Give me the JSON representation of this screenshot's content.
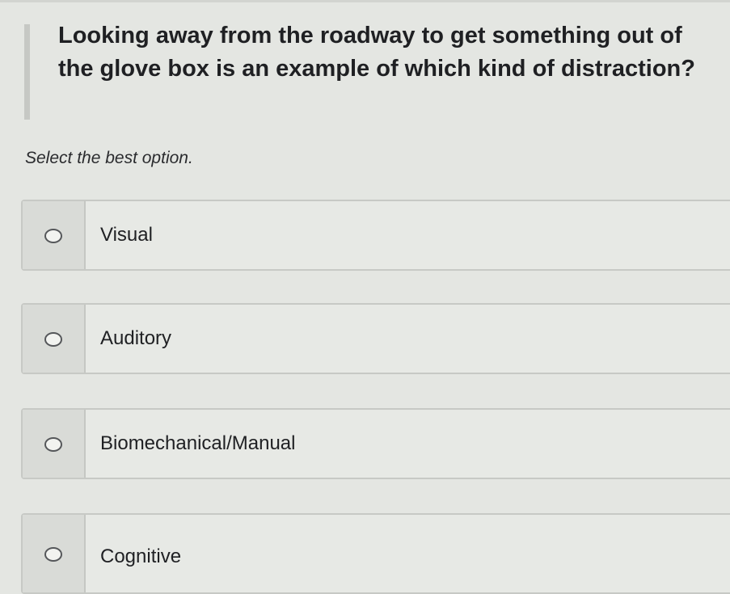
{
  "question": {
    "text": "Looking away from the roadway to get something out of the glove box is an example of which kind of distraction?",
    "instruction": "Select the best option."
  },
  "options": [
    {
      "label": "Visual",
      "selected": false
    },
    {
      "label": "Auditory",
      "selected": false
    },
    {
      "label": "Biomechanical/Manual",
      "selected": false
    },
    {
      "label": "Cognitive",
      "selected": false
    }
  ]
}
